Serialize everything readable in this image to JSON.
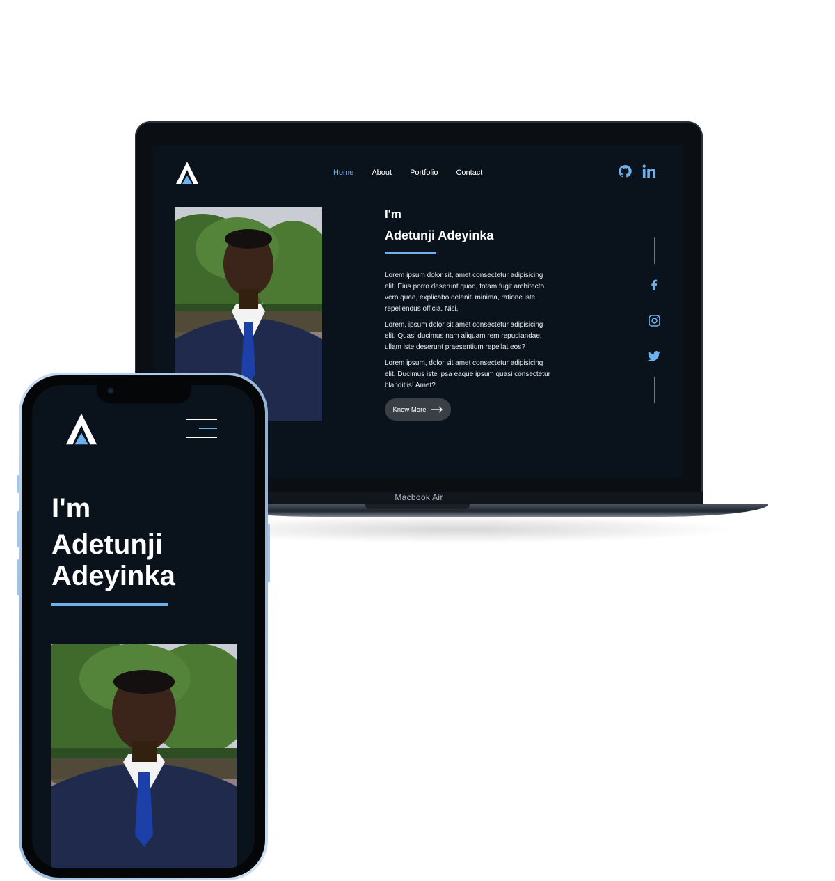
{
  "laptop": {
    "model_label": "Macbook Air",
    "nav": {
      "items": [
        {
          "label": "Home",
          "active": true
        },
        {
          "label": "About",
          "active": false
        },
        {
          "label": "Portfolio",
          "active": false
        },
        {
          "label": "Contact",
          "active": false
        }
      ]
    },
    "social_top": [
      "github-icon",
      "linkedin-icon"
    ],
    "social_side": [
      "facebook-icon",
      "instagram-icon",
      "twitter-icon"
    ],
    "hero": {
      "greeting": "I'm",
      "name": "Adetunji Adeyinka",
      "paragraphs": [
        "Lorem ipsum dolor sit, amet consectetur adipisicing elit. Eius porro deserunt quod, totam fugit architecto vero quae, explicabo deleniti minima, ratione iste repellendus officia. Nisi,",
        "Lorem, ipsum dolor sit amet consectetur adipisicing elit. Quasi ducimus nam aliquam rem repudiandae, ullam iste deserunt praesentium repellat eos?",
        "Lorem ipsum, dolor sit amet consectetur adipisicing elit. Ducimus iste ipsa eaque ipsum quasi consectetur blanditiis! Amet?"
      ],
      "cta_label": "Know More"
    }
  },
  "phone": {
    "hero": {
      "greeting": "I'm",
      "name": "Adetunji Adeyinka"
    }
  },
  "colors": {
    "accent": "#6fb1ec",
    "background": "#0a131b",
    "button": "#3a3f46"
  }
}
